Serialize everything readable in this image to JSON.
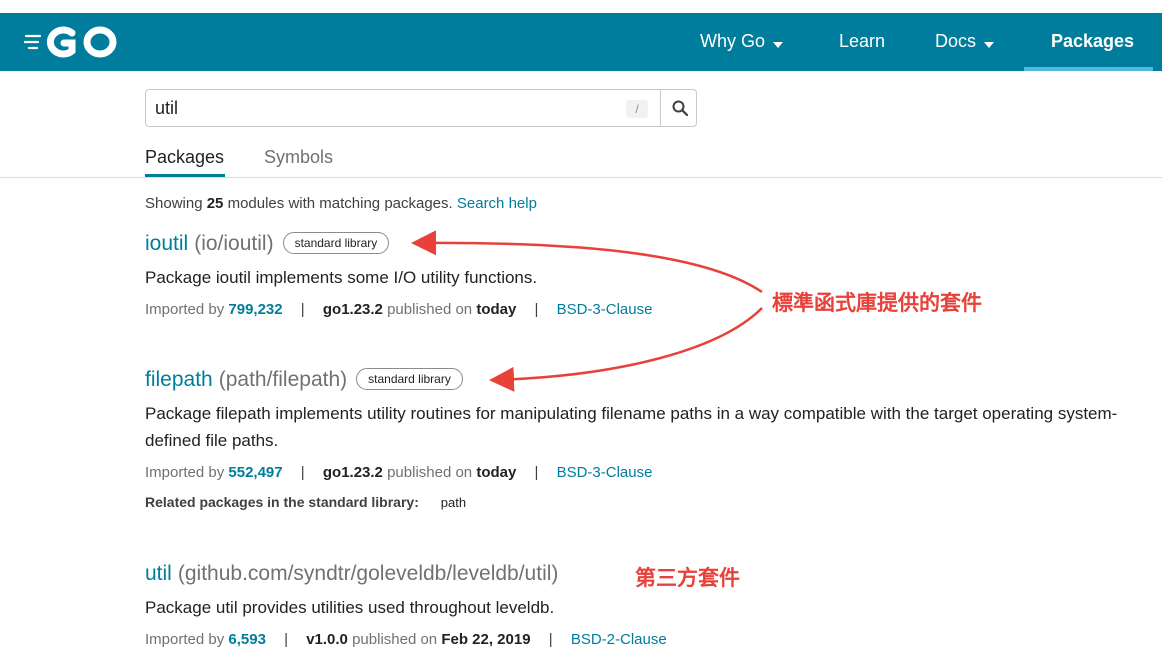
{
  "nav": {
    "items": [
      {
        "label": "Why Go",
        "dropdown": true
      },
      {
        "label": "Learn",
        "dropdown": false
      },
      {
        "label": "Docs",
        "dropdown": true
      },
      {
        "label": "Packages",
        "dropdown": false,
        "active": true
      }
    ]
  },
  "search": {
    "value": "util",
    "shortcut_hint": "/"
  },
  "tabs": [
    {
      "label": "Packages",
      "active": true
    },
    {
      "label": "Symbols",
      "active": false
    }
  ],
  "summary": {
    "prefix": "Showing",
    "count": "25",
    "suffix": "modules with matching packages.",
    "help_link": "Search help"
  },
  "results": [
    {
      "name": "ioutil",
      "path": "(io/ioutil)",
      "badge": "standard library",
      "synopsis": "Package ioutil implements some I/O utility functions.",
      "imported_label": "Imported by",
      "imported_count": "799,232",
      "version": "go1.23.2",
      "published_label": "published on",
      "published": "today",
      "license": "BSD-3-Clause"
    },
    {
      "name": "filepath",
      "path": "(path/filepath)",
      "badge": "standard library",
      "synopsis": "Package filepath implements utility routines for manipulating filename paths in a way compatible with the target operating system-defined file paths.",
      "imported_label": "Imported by",
      "imported_count": "552,497",
      "version": "go1.23.2",
      "published_label": "published on",
      "published": "today",
      "license": "BSD-3-Clause",
      "related_label": "Related packages in the standard library:",
      "related_link": "path"
    },
    {
      "name": "util",
      "path": "(github.com/syndtr/goleveldb/leveldb/util)",
      "synopsis": "Package util provides utilities used throughout leveldb.",
      "imported_label": "Imported by",
      "imported_count": "6,593",
      "version": "v1.0.0",
      "published_label": "published on",
      "published": "Feb 22, 2019",
      "license": "BSD-2-Clause"
    }
  ],
  "annotations": {
    "standard_library_note": "標準函式庫提供的套件",
    "third_party_note": "第三方套件",
    "color": "#e8413a"
  },
  "colors": {
    "header_bg": "#007d9c",
    "link": "#007d9c",
    "active_underline": "#50b7e0"
  }
}
